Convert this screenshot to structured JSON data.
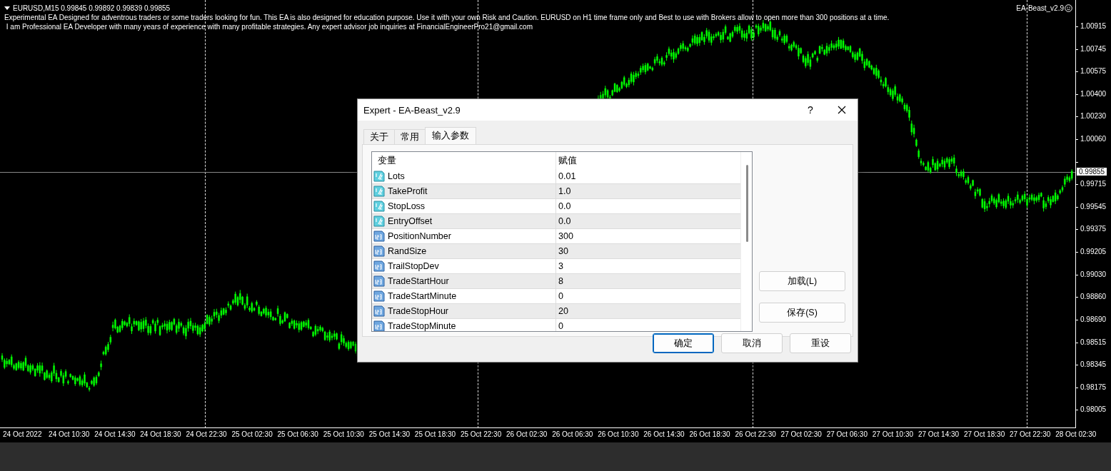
{
  "chart": {
    "symbol_line": "EURUSD,M15  0.99845 0.99892 0.99839 0.99855",
    "description_lines": [
      "Experimental EA Designed for adventrous traders or some traders looking for fun. This EA is also designed for education purpose. Use it with your own Risk and Caution. EURUSD on H1 time frame only and Best to use with Brokers allow to open more than 300 positions at a time.",
      " I am Professional EA Developer with many years of experience with many profitable strategies. Any expert advisor job inquiries at FinancialEngineerPro21@gmail.com"
    ],
    "expert_label": "EA-Beast_v2.9",
    "price_ticks_upper": [
      "1.00915",
      "1.00745",
      "1.00575",
      "1.00400",
      "1.00230",
      "1.00060"
    ],
    "price_ticks_lower": [
      "0.99715",
      "0.99545",
      "0.99375",
      "0.99205",
      "0.99030",
      "0.98860",
      "0.98690",
      "0.98515",
      "0.98345",
      "0.98175",
      "0.98005"
    ],
    "current_price": "0.99855",
    "time_ticks": [
      "24 Oct 2022",
      "24 Oct 10:30",
      "24 Oct 14:30",
      "24 Oct 18:30",
      "24 Oct 22:30",
      "25 Oct 02:30",
      "25 Oct 06:30",
      "25 Oct 10:30",
      "25 Oct 14:30",
      "25 Oct 18:30",
      "25 Oct 22:30",
      "26 Oct 02:30",
      "26 Oct 06:30",
      "26 Oct 10:30",
      "26 Oct 14:30",
      "26 Oct 18:30",
      "26 Oct 22:30",
      "27 Oct 02:30",
      "27 Oct 06:30",
      "27 Oct 10:30",
      "27 Oct 14:30",
      "27 Oct 18:30",
      "27 Oct 22:30",
      "28 Oct 02:30"
    ]
  },
  "dialog": {
    "title": "Expert - EA-Beast_v2.9",
    "help": "?",
    "tabs": [
      {
        "label": "关于",
        "selected": false
      },
      {
        "label": "常用",
        "selected": false
      },
      {
        "label": "输入参数",
        "selected": true
      }
    ],
    "table": {
      "columns": [
        "变量",
        "赋值"
      ],
      "rows": [
        {
          "kind": "double",
          "name": "Lots",
          "value": "0.01"
        },
        {
          "kind": "double",
          "name": "TakeProfit",
          "value": "1.0"
        },
        {
          "kind": "double",
          "name": "StopLoss",
          "value": "0.0"
        },
        {
          "kind": "double",
          "name": "EntryOffset",
          "value": "0.0"
        },
        {
          "kind": "int",
          "name": "PositionNumber",
          "value": "300"
        },
        {
          "kind": "int",
          "name": "RandSize",
          "value": "30"
        },
        {
          "kind": "int",
          "name": "TrailStopDev",
          "value": "3"
        },
        {
          "kind": "int",
          "name": "TradeStartHour",
          "value": "8"
        },
        {
          "kind": "int",
          "name": "TradeStartMinute",
          "value": "0"
        },
        {
          "kind": "int",
          "name": "TradeStopHour",
          "value": "20"
        },
        {
          "kind": "int",
          "name": "TradeStopMinute",
          "value": "0"
        }
      ]
    },
    "side_buttons": [
      "加载(L)",
      "保存(S)"
    ],
    "buttons": [
      {
        "label": "确定",
        "default": true
      },
      {
        "label": "取消",
        "default": false
      },
      {
        "label": "重设",
        "default": false
      }
    ]
  }
}
